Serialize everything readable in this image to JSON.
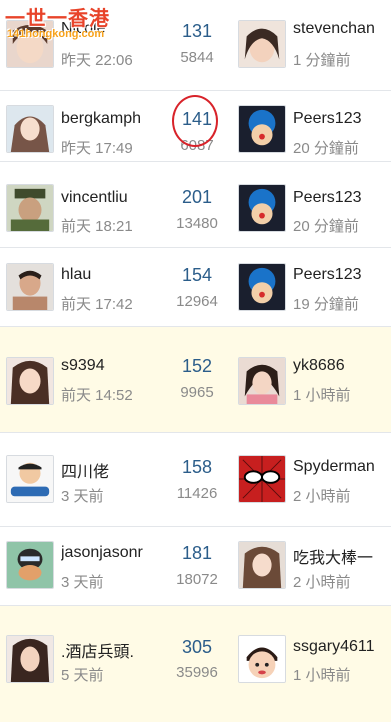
{
  "watermark": {
    "title": "一世一香港",
    "site": "141hongkong.com"
  },
  "rows": [
    {
      "author": "Nicole",
      "author_time": "昨天 22:06",
      "replies": "131",
      "views": "5844",
      "last_user": "stevenchan",
      "last_time": "1 分鐘前",
      "highlight": false
    },
    {
      "author": "bergkamph",
      "author_time": "昨天 17:49",
      "replies": "141",
      "views": "6087",
      "last_user": "Peers123",
      "last_time": "20 分鐘前",
      "highlight": false
    },
    {
      "author": "vincentliu",
      "author_time": "前天 18:21",
      "replies": "201",
      "views": "13480",
      "last_user": "Peers123",
      "last_time": "20 分鐘前",
      "highlight": false
    },
    {
      "author": "hlau",
      "author_time": "前天 17:42",
      "replies": "154",
      "views": "12964",
      "last_user": "Peers123",
      "last_time": "19 分鐘前",
      "highlight": false
    },
    {
      "author": "s9394",
      "author_time": "前天 14:52",
      "replies": "152",
      "views": "9965",
      "last_user": "yk8686",
      "last_time": "1 小時前",
      "highlight": true
    },
    {
      "author": "四川佬",
      "author_time": "3 天前",
      "replies": "158",
      "views": "11426",
      "last_user": "Spyderman",
      "last_time": "2 小時前",
      "highlight": false
    },
    {
      "author": "jasonjasonr",
      "author_time": "3 天前",
      "replies": "181",
      "views": "18072",
      "last_user": "吃我大棒一",
      "last_time": "2 小時前",
      "highlight": false
    },
    {
      "author": ".酒店兵頭.",
      "author_time": "5 天前",
      "replies": "305",
      "views": "35996",
      "last_user": "ssgary4611",
      "last_time": "1 小時前",
      "highlight": true
    }
  ],
  "colors": {
    "accent": "#2b5d8a",
    "highlight_bg": "#fffbe6",
    "circle": "#d8232a"
  }
}
